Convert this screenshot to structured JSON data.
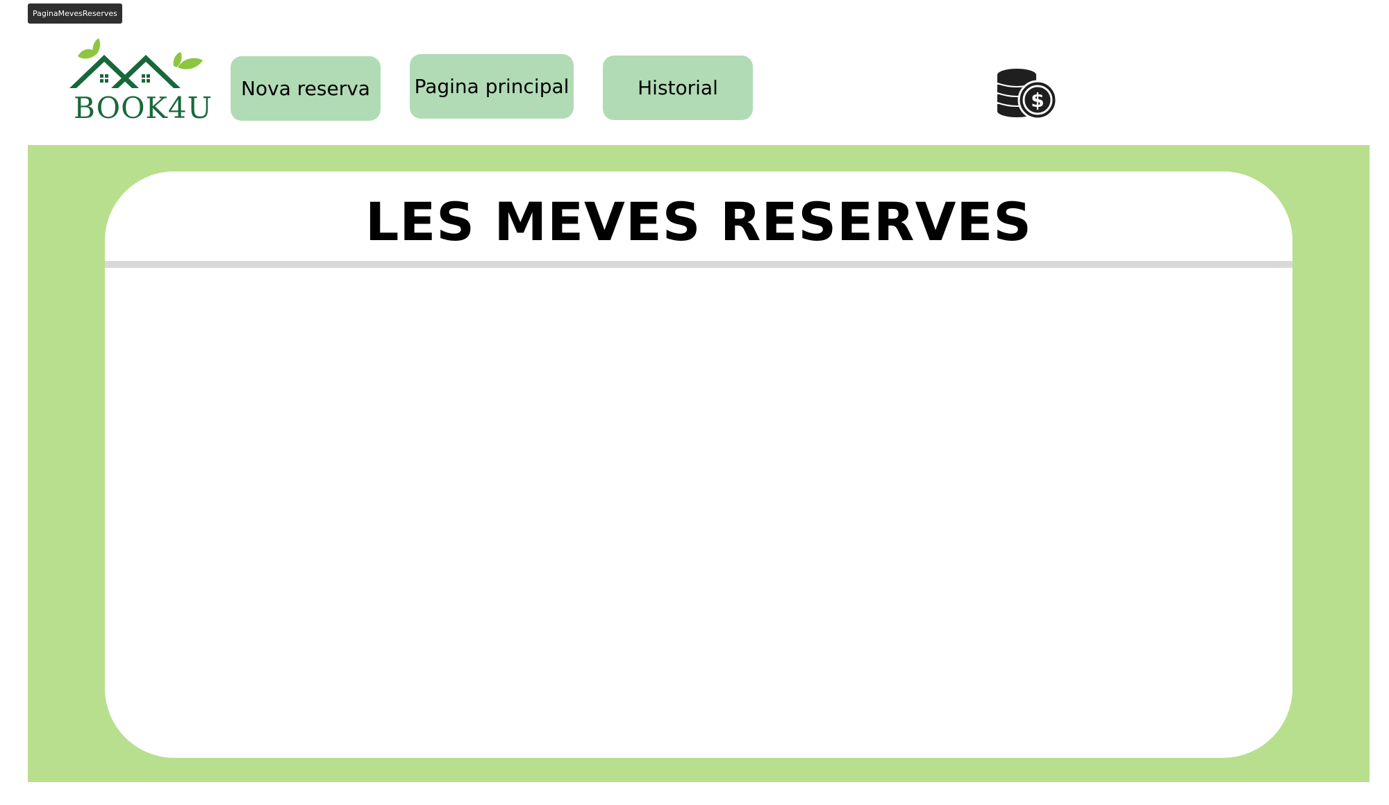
{
  "frame": {
    "tag_label": "PaginaMevesReserves"
  },
  "header": {
    "logo": {
      "text": "BOOK4U",
      "icon": "houses-with-leaves-logo"
    },
    "nav": [
      {
        "label": "Nova reserva"
      },
      {
        "label": "Pagina principal"
      },
      {
        "label": "Historial"
      }
    ],
    "wallet": {
      "icon": "coins-dollar-icon"
    }
  },
  "main": {
    "title": "LES MEVES RESERVES"
  },
  "colors": {
    "nav_button_bg": "#b1dbb5",
    "stage_bg": "#b8df8e",
    "card_bg": "#ffffff",
    "divider": "#d9d9d9",
    "logo_green": "#17683a",
    "leaf_green": "#8cc63f",
    "frame_tag_bg": "#2f2f2f"
  }
}
